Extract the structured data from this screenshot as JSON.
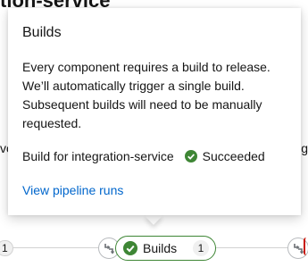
{
  "background": {
    "page_title": "tion-service",
    "left_fragment": "vo",
    "right_fragment": "g"
  },
  "popover": {
    "title": "Builds",
    "body": "Every component requires a build to release. We’ll automatically trigger a single build. Subsequent builds will need to be manually requested.",
    "status_label": "Build for integration-service",
    "status_value": "Succeeded",
    "link_label": "View pipeline runs"
  },
  "pipeline": {
    "left_badge": "1",
    "node_label": "Builds",
    "node_count": "1"
  },
  "colors": {
    "success": "#3e8635",
    "link": "#0066cc",
    "error": "#c9190b"
  },
  "icons": {
    "status": "check-circle-icon",
    "connector": "pipeline-connector-icon"
  }
}
